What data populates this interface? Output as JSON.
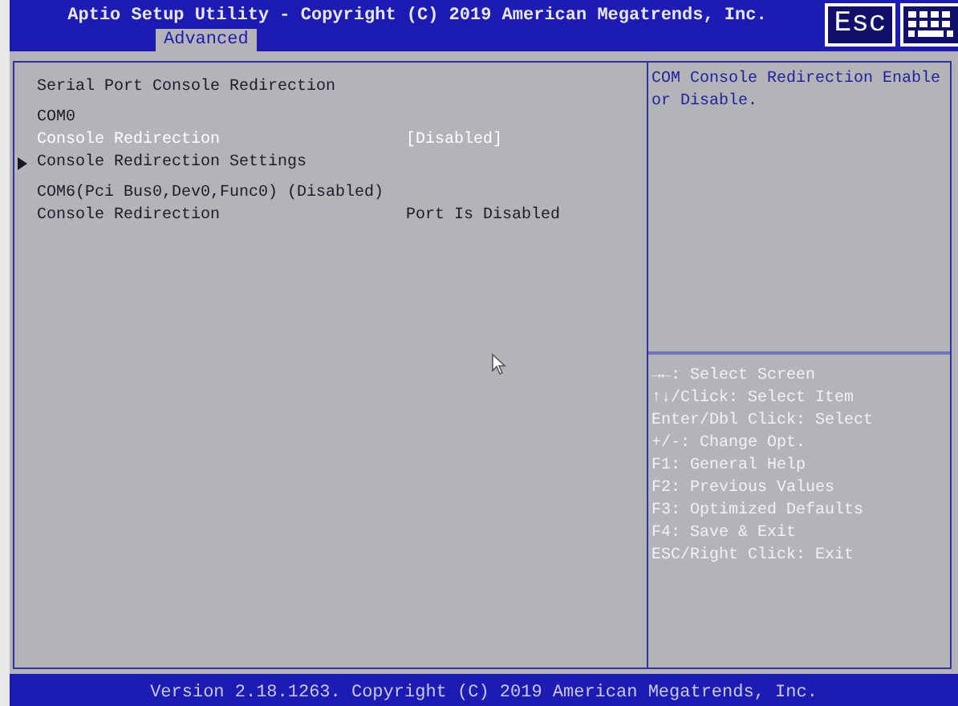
{
  "header": {
    "title": "Aptio Setup Utility - Copyright (C) 2019 American Megatrends, Inc.",
    "tabs": [
      {
        "label": "Advanced",
        "selected": true
      }
    ],
    "esc_key": "Esc"
  },
  "items": [
    {
      "kind": "title",
      "label": "Serial Port Console Redirection"
    },
    {
      "kind": "gap"
    },
    {
      "kind": "heading",
      "label": "COM0"
    },
    {
      "kind": "setting",
      "label": "Console Redirection",
      "value": "[Disabled]",
      "selected": true
    },
    {
      "kind": "submenu",
      "label": "Console Redirection Settings",
      "selected": false
    },
    {
      "kind": "gap"
    },
    {
      "kind": "heading",
      "label": "COM6(Pci Bus0,Dev0,Func0) (Disabled)"
    },
    {
      "kind": "setting",
      "label": "Console Redirection",
      "value": "Port Is Disabled",
      "selected": false
    }
  ],
  "help": {
    "text": "COM Console Redirection Enable or Disable.",
    "keys": [
      "→←: Select Screen",
      "↑↓/Click: Select Item",
      "Enter/Dbl Click: Select",
      "+/-: Change Opt.",
      "F1: General Help",
      "F2: Previous Values",
      "F3: Optimized Defaults",
      "F4: Save & Exit",
      "ESC/Right Click: Exit"
    ]
  },
  "footer": "Version 2.18.1263. Copyright (C) 2019 American Megatrends, Inc."
}
